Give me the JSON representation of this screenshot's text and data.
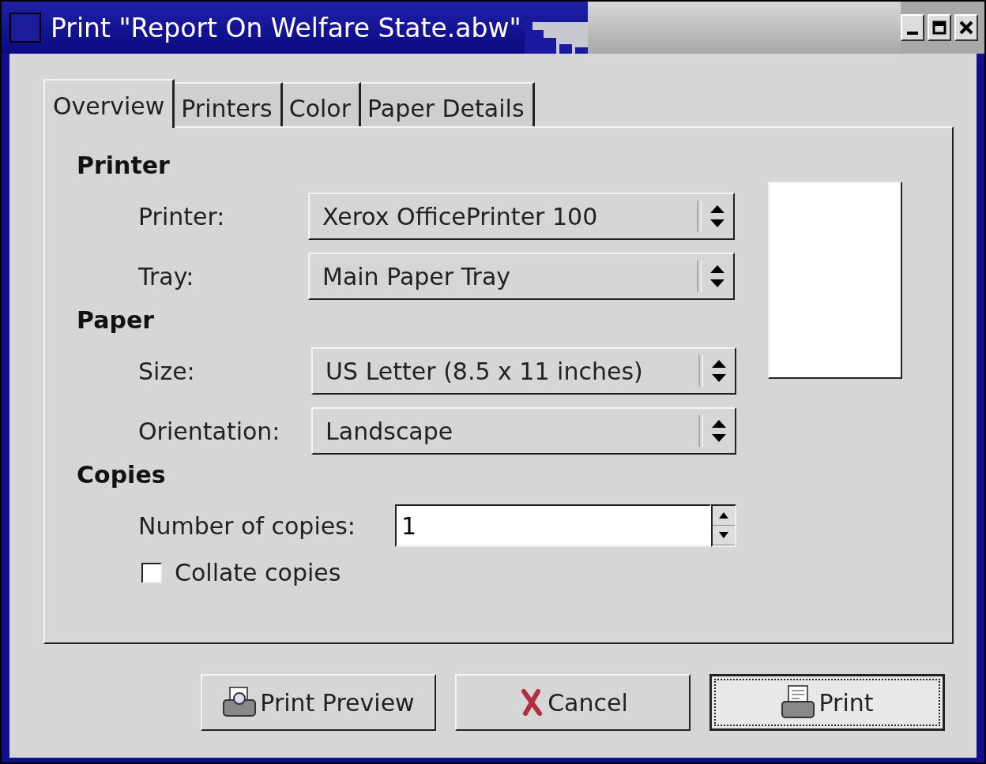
{
  "window": {
    "title": "Print \"Report On Welfare State.abw\""
  },
  "tabs": [
    {
      "label": "Overview",
      "selected": true
    },
    {
      "label": "Printers",
      "selected": false
    },
    {
      "label": "Color",
      "selected": false
    },
    {
      "label": "Paper Details",
      "selected": false
    }
  ],
  "sections": [
    {
      "heading": "Printer",
      "fields": [
        {
          "label": "Printer:",
          "value": "Xerox OfficePrinter 100"
        },
        {
          "label": "Tray:",
          "value": "Main Paper Tray"
        }
      ]
    },
    {
      "heading": "Paper",
      "fields": [
        {
          "label": "Size:",
          "value": "US Letter (8.5 x 11 inches)"
        },
        {
          "label": "Orientation:",
          "value": "Landscape"
        }
      ]
    }
  ],
  "copies": {
    "heading": "Copies",
    "label": "Number of copies:",
    "value": "1",
    "collate": {
      "label": "Collate copies",
      "checked": false
    }
  },
  "buttons": [
    {
      "label": "Print Preview",
      "kind": "preview",
      "default": false
    },
    {
      "label": "Cancel",
      "kind": "cancel",
      "default": false
    },
    {
      "label": "Print",
      "kind": "print",
      "default": true
    }
  ]
}
